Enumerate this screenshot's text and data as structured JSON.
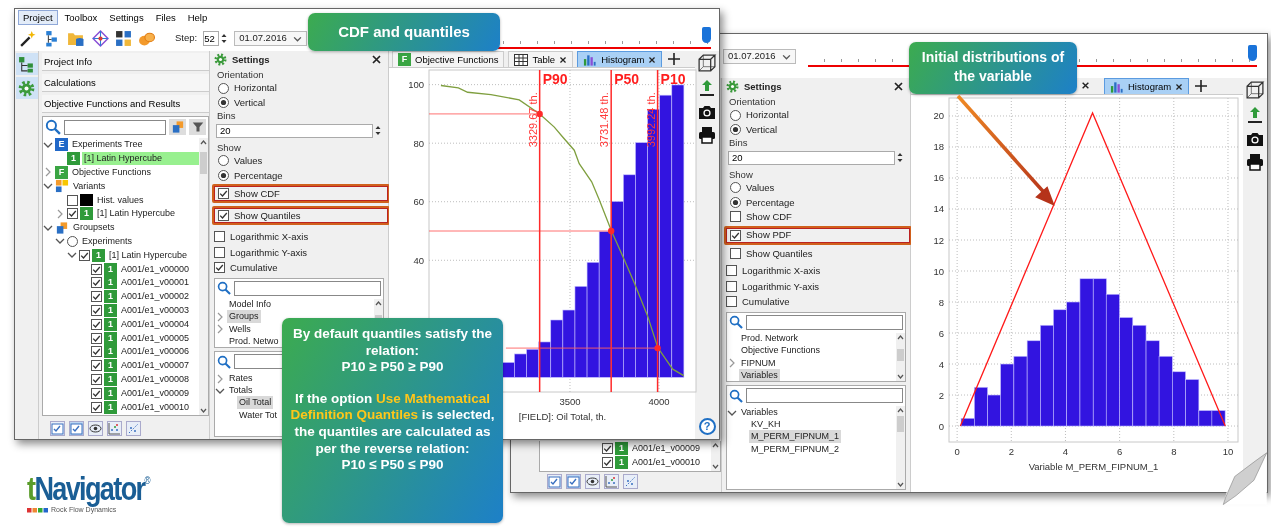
{
  "window_left": {
    "menu": [
      {
        "label": "Project",
        "selected": true
      },
      {
        "label": "Toolbox",
        "selected": false
      },
      {
        "label": "Settings",
        "selected": false
      },
      {
        "label": "Files",
        "selected": false
      },
      {
        "label": "Help",
        "selected": false
      }
    ],
    "toolbar": {
      "step_label": "Step:",
      "step": "52",
      "date": "01.07.2016",
      "timeline": {
        "level": 1
      }
    },
    "sections": [
      "Project Info",
      "Calculations",
      "Objective Functions and Results"
    ],
    "tree": [
      {
        "label": "Experiments Tree",
        "kind": "experiments",
        "icon_text": "E",
        "expanded": true,
        "selected": false,
        "children": [
          {
            "label": "[1] Latin Hypercube",
            "kind": "run",
            "icon_text": "1",
            "selected": true
          }
        ]
      },
      {
        "label": "Objective Functions",
        "kind": "objectives",
        "icon_text": "F",
        "expanded": false,
        "selected": false
      },
      {
        "label": "Variants",
        "kind": "variants",
        "expanded": true,
        "selected": false,
        "children": [
          {
            "label": "Hist. values",
            "kind": "swatch",
            "color": "#000000",
            "checkbox": false,
            "selected": false
          },
          {
            "label": "[1] Latin Hypercube",
            "kind": "run",
            "icon_text": "1",
            "expanded": false,
            "checkbox": true,
            "selected": false
          }
        ]
      },
      {
        "label": "Groupsets",
        "kind": "groupsets",
        "expanded": true,
        "selected": false,
        "children": [
          {
            "label": "Experiments",
            "radio": false,
            "expanded": true,
            "selected": false,
            "children": [
              {
                "label": "[1] Latin Hypercube",
                "kind": "run",
                "icon_text": "1",
                "expanded": true,
                "checkbox": true,
                "selected": false,
                "children": [
                  {
                    "label": "A001/e1_v00000",
                    "kind": "run",
                    "icon_text": "1",
                    "checkbox": true,
                    "selected": false
                  },
                  {
                    "label": "A001/e1_v00001",
                    "kind": "run",
                    "icon_text": "1",
                    "checkbox": true,
                    "selected": false
                  },
                  {
                    "label": "A001/e1_v00002",
                    "kind": "run",
                    "icon_text": "1",
                    "checkbox": true,
                    "selected": false
                  },
                  {
                    "label": "A001/e1_v00003",
                    "kind": "run",
                    "icon_text": "1",
                    "checkbox": true,
                    "selected": false
                  },
                  {
                    "label": "A001/e1_v00004",
                    "kind": "run",
                    "icon_text": "1",
                    "checkbox": true,
                    "selected": false
                  },
                  {
                    "label": "A001/e1_v00005",
                    "kind": "run",
                    "icon_text": "1",
                    "checkbox": true,
                    "selected": false
                  },
                  {
                    "label": "A001/e1_v00006",
                    "kind": "run",
                    "icon_text": "1",
                    "checkbox": true,
                    "selected": false
                  },
                  {
                    "label": "A001/e1_v00007",
                    "kind": "run",
                    "icon_text": "1",
                    "checkbox": true,
                    "selected": false
                  },
                  {
                    "label": "A001/e1_v00008",
                    "kind": "run",
                    "icon_text": "1",
                    "checkbox": true,
                    "selected": false
                  },
                  {
                    "label": "A001/e1_v00009",
                    "kind": "run",
                    "icon_text": "1",
                    "checkbox": true,
                    "selected": false
                  },
                  {
                    "label": "A001/e1_v00010",
                    "kind": "run",
                    "icon_text": "1",
                    "checkbox": true,
                    "selected": false
                  }
                ]
              }
            ]
          }
        ]
      }
    ],
    "settings": {
      "title": "Settings",
      "orientation": {
        "label": "Orientation",
        "options": [
          {
            "label": "Horizontal",
            "checked": false
          },
          {
            "label": "Vertical",
            "checked": true
          }
        ]
      },
      "bins": {
        "label": "Bins",
        "value": "20"
      },
      "show": {
        "label": "Show",
        "options": [
          {
            "label": "Values",
            "kind": "radio",
            "checked": false,
            "highlighted": false
          },
          {
            "label": "Percentage",
            "kind": "radio",
            "checked": true,
            "highlighted": false
          },
          {
            "label": "Show CDF",
            "kind": "checkbox",
            "checked": true,
            "highlighted": true
          },
          {
            "label": "Show Quantiles",
            "kind": "checkbox",
            "checked": true,
            "highlighted": true
          }
        ]
      },
      "axes": [
        {
          "label": "Logarithmic X-axis",
          "checked": false
        },
        {
          "label": "Logarithmic Y-axis",
          "checked": false
        },
        {
          "label": "Cumulative",
          "checked": true
        }
      ],
      "lists": [
        {
          "items": [
            {
              "label": "Model Info",
              "selected": false
            },
            {
              "label": "Groups",
              "expanded": false,
              "selected": true
            },
            {
              "label": "Wells",
              "expanded": false,
              "selected": false
            },
            {
              "label": "Prod. Netwo",
              "selected": false
            }
          ]
        },
        {
          "items": [
            {
              "label": "Rates",
              "expanded": false,
              "selected": false
            },
            {
              "label": "Totals",
              "expanded": true,
              "selected": false,
              "children": [
                {
                  "label": "Oil Total",
                  "selected": true
                },
                {
                  "label": "Water Tot",
                  "selected": false
                }
              ]
            }
          ]
        }
      ]
    },
    "tabs": [
      {
        "label": "Objective Functions",
        "kind": "objectives",
        "icon_text": "F",
        "selected": false
      },
      {
        "label": "Table",
        "kind": "table",
        "closable": true,
        "selected": false
      },
      {
        "label": "Histogram",
        "kind": "histogram",
        "closable": true,
        "selected": true
      }
    ],
    "help": "?",
    "chart_data": {
      "type": "bar",
      "xlabel": "[FIELD]: Oil Total, th.",
      "x": [
        3154,
        3222,
        3290,
        3358,
        3426,
        3494,
        3562,
        3630,
        3698,
        3766,
        3834,
        3902,
        3970,
        4038,
        4106
      ],
      "series": [
        {
          "color": "#3214e0",
          "values": [
            5.1,
            8,
            9.6,
            12.1,
            19.6,
            23,
            31.1,
            39.3,
            49.8,
            60.1,
            69.2,
            80.2,
            91.6,
            96.4,
            99.9
          ]
        },
        {
          "type": "line",
          "color": "#7f9f3f",
          "x": [
            2775,
            2873,
            2925,
            3056,
            3215,
            3330,
            3412,
            3459,
            3524,
            3552,
            3622,
            3665,
            3732,
            3805,
            3861,
            3936,
            3993,
            4077,
            4139
          ],
          "values": [
            99.7,
            98.9,
            97.4,
            96.6,
            94.8,
            90,
            85.5,
            82.1,
            77.6,
            73,
            66.8,
            60.6,
            50.2,
            40.2,
            32.3,
            21,
            10.2,
            2.8,
            0.6
          ]
        },
        {
          "type": "line",
          "color": "#ff6060",
          "x": [
            2708,
            3329.67
          ],
          "values": [
            90,
            90
          ]
        },
        {
          "type": "line",
          "color": "#ff6060",
          "x": [
            2708,
            3731.48
          ],
          "values": [
            50,
            50
          ]
        },
        {
          "type": "line",
          "color": "#ff6060",
          "x": [
            3140,
            3992.24
          ],
          "values": [
            10,
            10
          ]
        },
        {
          "type": "scatter",
          "color": "#ff2a2a",
          "x": [
            3329.67,
            3731.48,
            3992.24
          ],
          "values": [
            90,
            50,
            10
          ]
        }
      ],
      "xlim": [
        2708,
        4208
      ],
      "ylim": [
        -5,
        105
      ],
      "xticks": [
        3500,
        4000
      ],
      "yticks": [
        40,
        60,
        80,
        100
      ],
      "grid": true,
      "ref_lines": [
        {
          "axis": "x",
          "value": 3329.67,
          "label": "P90"
        },
        {
          "axis": "x",
          "value": 3731.48,
          "label": "P50"
        },
        {
          "axis": "x",
          "value": 3992.24,
          "label": "P10"
        }
      ],
      "annotations": [
        {
          "text": "3329.67 th.",
          "x": 3329.67,
          "y": 88
        },
        {
          "text": "3731.48 th.",
          "x": 3731.48,
          "y": 88
        },
        {
          "text": "3992.24 th.",
          "x": 3992.24,
          "y": 88
        }
      ]
    }
  },
  "window_right": {
    "toolbar": {
      "date": "01.07.2016",
      "timeline": {
        "level": 1
      }
    },
    "tree_rows": [
      {
        "label": "A001/e1_v00009",
        "kind": "run",
        "icon_text": "1",
        "checkbox": true,
        "selected": false
      },
      {
        "label": "A001/e1_v00010",
        "kind": "run",
        "icon_text": "1",
        "checkbox": true,
        "selected": false
      }
    ],
    "settings": {
      "title": "Settings",
      "orientation": {
        "label": "Orientation",
        "options": [
          {
            "label": "Horizontal",
            "checked": false
          },
          {
            "label": "Vertical",
            "checked": true
          }
        ]
      },
      "bins": {
        "label": "Bins",
        "value": "20"
      },
      "show": {
        "label": "Show",
        "options": [
          {
            "label": "Values",
            "kind": "radio",
            "checked": false,
            "highlighted": false
          },
          {
            "label": "Percentage",
            "kind": "radio",
            "checked": true,
            "highlighted": false
          },
          {
            "label": "Show CDF",
            "kind": "checkbox",
            "checked": false,
            "highlighted": false
          },
          {
            "label": "Show PDF",
            "kind": "checkbox",
            "checked": true,
            "highlighted": true
          },
          {
            "label": "Show Quantiles",
            "kind": "checkbox",
            "checked": false,
            "highlighted": false
          }
        ]
      },
      "axes": [
        {
          "label": "Logarithmic X-axis",
          "checked": false
        },
        {
          "label": "Logarithmic Y-axis",
          "checked": false
        },
        {
          "label": "Cumulative",
          "checked": false
        }
      ],
      "lists": [
        {
          "items": [
            {
              "label": "Prod. Network",
              "selected": false
            },
            {
              "label": "Objective Functions",
              "selected": false
            },
            {
              "label": "FIPNUM",
              "expanded": false,
              "selected": false
            },
            {
              "label": "Variables",
              "selected": true
            }
          ]
        },
        {
          "items": [
            {
              "label": "Variables",
              "expanded": true,
              "selected": false,
              "children": [
                {
                  "label": "KV_KH",
                  "selected": false
                },
                {
                  "label": "M_PERM_FIPNUM_1",
                  "selected": true
                },
                {
                  "label": "M_PERM_FIPNUM_2",
                  "selected": false
                }
              ]
            }
          ]
        }
      ]
    },
    "tabs": [
      {
        "kind": "close_only",
        "selected": false
      },
      {
        "label": "Histogram",
        "kind": "histogram",
        "closable": true,
        "selected": true
      }
    ],
    "chart_data": {
      "type": "bar",
      "xlabel": "Variable M_PERM_FIPNUM_1",
      "x": [
        0.39,
        0.88,
        1.37,
        1.85,
        2.34,
        2.83,
        3.32,
        3.8,
        4.29,
        4.78,
        5.27,
        5.75,
        6.24,
        6.73,
        7.22,
        7.7,
        8.19,
        8.68,
        9.17,
        9.65
      ],
      "series": [
        {
          "color": "#3214e0",
          "values": [
            0.5,
            2.5,
            2,
            4,
            4.5,
            5.5,
            6.5,
            7.5,
            8,
            9.5,
            9.5,
            8.5,
            7,
            6.5,
            5.5,
            4.5,
            3.5,
            3,
            1,
            1
          ]
        },
        {
          "type": "line",
          "color": "#ff1a1a",
          "x": [
            0.12,
            5,
            9.9
          ],
          "values": [
            0,
            20.2,
            0
          ]
        }
      ],
      "xlim": [
        -0.3,
        10.37
      ],
      "ylim": [
        -1.03,
        21.16
      ],
      "xticks": [
        0,
        2,
        4,
        6,
        8,
        10
      ],
      "yticks": [
        0,
        2,
        4,
        6,
        8,
        10,
        12,
        14,
        16,
        18,
        20
      ],
      "grid": true
    }
  },
  "callouts": [
    {
      "text": "CDF and quantiles"
    },
    {
      "text": "Initial distributions of the variable"
    }
  ],
  "note": {
    "blocks": [
      {
        "paragraphs": [
          {
            "segments": [
              {
                "text": "By default quantiles satisfy the relation:",
                "highlight": false
              }
            ]
          },
          {
            "segments": [
              {
                "text": "P10 ≥ P50 ≥ P90",
                "highlight": false
              }
            ]
          }
        ]
      },
      {
        "paragraphs": [
          {
            "segments": [
              {
                "text": "If the option ",
                "highlight": false
              },
              {
                "text": "Use Mathematical Definition Quantiles",
                "highlight": true
              },
              {
                "text": " is selected, the quantiles are calculated as per the reverse relation:",
                "highlight": false
              }
            ]
          },
          {
            "segments": [
              {
                "text": "P10 ≤ P50 ≤ P90",
                "highlight": false
              }
            ]
          }
        ]
      }
    ]
  },
  "logo": {
    "lead": "t",
    "rest": "Navigator",
    "mark": "®",
    "tagline": "Rock Flow Dynamics"
  }
}
